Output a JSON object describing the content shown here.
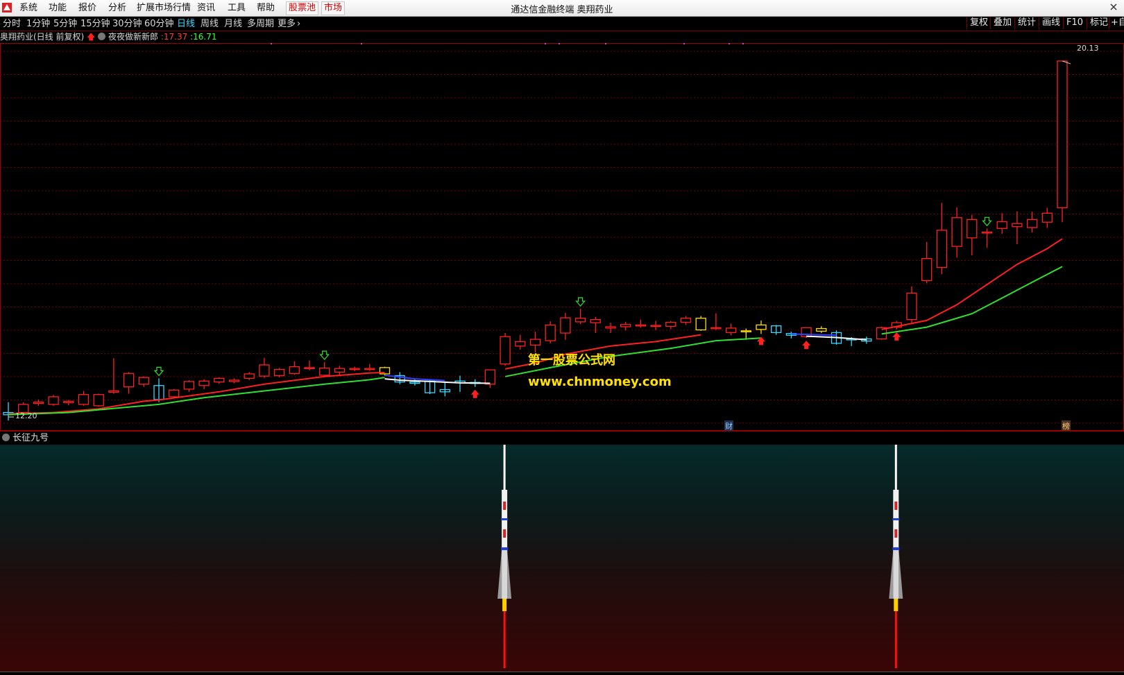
{
  "menu": {
    "items": [
      "系统",
      "功能",
      "报价",
      "分析",
      "扩展市场行情",
      "资讯",
      "工具",
      "帮助"
    ],
    "highlight_items": [
      "股票池",
      "市场"
    ],
    "app_title": "通达信金融终端  奥翔药业"
  },
  "toolbar": {
    "periods": [
      "分时",
      "1分钟",
      "5分钟",
      "15分钟",
      "30分钟",
      "60分钟",
      "日线",
      "周线",
      "月线",
      "多周期",
      "更多"
    ],
    "active_period": "日线",
    "right_buttons": [
      "复权",
      "叠加",
      "统计",
      "画线",
      "F10",
      "标记",
      "+自"
    ]
  },
  "chart_header": {
    "stock_name": "奥翔药业(日线 前复权)",
    "indicator_name": "夜夜做新新郎",
    "value1": ":17.37",
    "value2": ":16.71"
  },
  "price_labels": {
    "high": "20.13",
    "low": "12.20"
  },
  "event_labels": {
    "cai": "财",
    "bang": "榜"
  },
  "watermark": {
    "line1": "第一股票公式网",
    "line2": "www.chnmoney.com"
  },
  "sub_indicator": {
    "name": "长征九号"
  },
  "colors": {
    "up": "#ff2020",
    "down": "#38d8ff",
    "yellow": "#ffe000",
    "ma_red": "#ff2020",
    "ma_green": "#30e030",
    "grid": "#7a0000"
  },
  "chart_data": {
    "type": "candlestick",
    "title": "奥翔药业(日线 前复权)",
    "ylim": [
      12.0,
      20.5
    ],
    "candles": [
      {
        "o": 12.25,
        "h": 12.53,
        "l": 12.12,
        "c": 12.3,
        "k": "down"
      },
      {
        "o": 12.3,
        "h": 12.53,
        "l": 12.22,
        "c": 12.48,
        "k": "up"
      },
      {
        "o": 12.5,
        "h": 12.59,
        "l": 12.45,
        "c": 12.53,
        "k": "up"
      },
      {
        "o": 12.48,
        "h": 12.69,
        "l": 12.45,
        "c": 12.65,
        "k": "up"
      },
      {
        "o": 12.52,
        "h": 12.58,
        "l": 12.46,
        "c": 12.55,
        "k": "up"
      },
      {
        "o": 12.48,
        "h": 12.78,
        "l": 12.45,
        "c": 12.7,
        "k": "up"
      },
      {
        "o": 12.45,
        "h": 12.72,
        "l": 12.43,
        "c": 12.7,
        "k": "up"
      },
      {
        "o": 12.75,
        "h": 13.51,
        "l": 12.72,
        "c": 12.78,
        "k": "up"
      },
      {
        "o": 12.87,
        "h": 13.2,
        "l": 12.72,
        "c": 13.17,
        "k": "up"
      },
      {
        "o": 12.93,
        "h": 13.1,
        "l": 12.87,
        "c": 13.08,
        "k": "up"
      },
      {
        "o": 12.9,
        "h": 13.06,
        "l": 12.53,
        "c": 12.59,
        "k": "down"
      },
      {
        "o": 12.65,
        "h": 12.82,
        "l": 12.62,
        "c": 12.8,
        "k": "up"
      },
      {
        "o": 12.82,
        "h": 13.02,
        "l": 12.76,
        "c": 12.99,
        "k": "up"
      },
      {
        "o": 12.9,
        "h": 13.04,
        "l": 12.82,
        "c": 13.0,
        "k": "up"
      },
      {
        "o": 12.98,
        "h": 13.08,
        "l": 12.94,
        "c": 13.06,
        "k": "up"
      },
      {
        "o": 12.99,
        "h": 13.06,
        "l": 12.95,
        "c": 13.02,
        "k": "up"
      },
      {
        "o": 13.06,
        "h": 13.2,
        "l": 13.02,
        "c": 13.16,
        "k": "up"
      },
      {
        "o": 13.11,
        "h": 13.52,
        "l": 13.07,
        "c": 13.36,
        "k": "up"
      },
      {
        "o": 13.12,
        "h": 13.29,
        "l": 13.08,
        "c": 13.26,
        "k": "up"
      },
      {
        "o": 13.17,
        "h": 13.44,
        "l": 13.14,
        "c": 13.32,
        "k": "up"
      },
      {
        "o": 13.28,
        "h": 13.46,
        "l": 13.24,
        "c": 13.3,
        "k": "up"
      },
      {
        "o": 13.13,
        "h": 13.42,
        "l": 13.1,
        "c": 13.29,
        "k": "up"
      },
      {
        "o": 13.2,
        "h": 13.34,
        "l": 13.11,
        "c": 13.28,
        "k": "up"
      },
      {
        "o": 13.26,
        "h": 13.32,
        "l": 13.22,
        "c": 13.28,
        "k": "up"
      },
      {
        "o": 13.26,
        "h": 13.38,
        "l": 13.23,
        "c": 13.28,
        "k": "up"
      },
      {
        "o": 13.16,
        "h": 13.32,
        "l": 13.12,
        "c": 13.3,
        "k": "yellow"
      },
      {
        "o": 13.12,
        "h": 13.2,
        "l": 12.93,
        "c": 12.98,
        "k": "down"
      },
      {
        "o": 12.98,
        "h": 13.04,
        "l": 12.9,
        "c": 12.95,
        "k": "down"
      },
      {
        "o": 13.0,
        "h": 13.03,
        "l": 12.71,
        "c": 12.74,
        "k": "down"
      },
      {
        "o": 12.76,
        "h": 12.99,
        "l": 12.66,
        "c": 12.81,
        "k": "down"
      },
      {
        "o": 13.0,
        "h": 13.12,
        "l": 12.76,
        "c": 12.96,
        "k": "down"
      },
      {
        "o": 12.97,
        "h": 13.04,
        "l": 12.87,
        "c": 12.95,
        "k": "down"
      },
      {
        "o": 12.93,
        "h": 13.25,
        "l": 12.85,
        "c": 13.25,
        "k": "up"
      },
      {
        "o": 13.38,
        "h": 14.07,
        "l": 13.34,
        "c": 13.99,
        "k": "up"
      },
      {
        "o": 13.78,
        "h": 14.03,
        "l": 13.7,
        "c": 13.88,
        "k": "up"
      },
      {
        "o": 13.8,
        "h": 14.1,
        "l": 13.64,
        "c": 13.93,
        "k": "up"
      },
      {
        "o": 13.9,
        "h": 14.33,
        "l": 13.84,
        "c": 14.25,
        "k": "up"
      },
      {
        "o": 14.07,
        "h": 14.52,
        "l": 13.92,
        "c": 14.41,
        "k": "up"
      },
      {
        "o": 14.32,
        "h": 14.61,
        "l": 14.27,
        "c": 14.4,
        "k": "up"
      },
      {
        "o": 14.3,
        "h": 14.43,
        "l": 14.07,
        "c": 14.37,
        "k": "up"
      },
      {
        "o": 14.18,
        "h": 14.3,
        "l": 14.07,
        "c": 14.21,
        "k": "up"
      },
      {
        "o": 14.21,
        "h": 14.32,
        "l": 14.13,
        "c": 14.26,
        "k": "up"
      },
      {
        "o": 14.24,
        "h": 14.37,
        "l": 14.19,
        "c": 14.25,
        "k": "up"
      },
      {
        "o": 14.22,
        "h": 14.34,
        "l": 14.14,
        "c": 14.24,
        "k": "up"
      },
      {
        "o": 14.22,
        "h": 14.34,
        "l": 14.16,
        "c": 14.31,
        "k": "up"
      },
      {
        "o": 14.31,
        "h": 14.45,
        "l": 14.25,
        "c": 14.4,
        "k": "up"
      },
      {
        "o": 14.4,
        "h": 14.45,
        "l": 14.12,
        "c": 14.14,
        "k": "yellow"
      },
      {
        "o": 14.19,
        "h": 14.51,
        "l": 14.14,
        "c": 14.18,
        "k": "up"
      },
      {
        "o": 14.18,
        "h": 14.28,
        "l": 14.02,
        "c": 14.08,
        "k": "up"
      },
      {
        "o": 14.12,
        "h": 14.17,
        "l": 13.92,
        "c": 14.12,
        "k": "yellow"
      },
      {
        "o": 14.15,
        "h": 14.35,
        "l": 14.05,
        "c": 14.25,
        "k": "yellow"
      },
      {
        "o": 14.23,
        "h": 14.25,
        "l": 14.03,
        "c": 14.08,
        "k": "down"
      },
      {
        "o": 14.06,
        "h": 14.1,
        "l": 13.95,
        "c": 14.02,
        "k": "down"
      },
      {
        "o": 13.99,
        "h": 14.2,
        "l": 13.96,
        "c": 14.19,
        "k": "up"
      },
      {
        "o": 14.11,
        "h": 14.22,
        "l": 14.07,
        "c": 14.17,
        "k": "yellow"
      },
      {
        "o": 14.08,
        "h": 14.13,
        "l": 13.81,
        "c": 13.84,
        "k": "down"
      },
      {
        "o": 13.94,
        "h": 13.98,
        "l": 13.78,
        "c": 13.92,
        "k": "down"
      },
      {
        "o": 13.89,
        "h": 13.99,
        "l": 13.83,
        "c": 13.94,
        "k": "down"
      },
      {
        "o": 13.94,
        "h": 14.21,
        "l": 13.92,
        "c": 14.19,
        "k": "up"
      },
      {
        "o": 14.2,
        "h": 14.34,
        "l": 14.15,
        "c": 14.3,
        "k": "up"
      },
      {
        "o": 14.37,
        "h": 15.11,
        "l": 14.3,
        "c": 14.96,
        "k": "up"
      },
      {
        "o": 15.24,
        "h": 16.1,
        "l": 15.18,
        "c": 15.73,
        "k": "up"
      },
      {
        "o": 15.53,
        "h": 16.97,
        "l": 15.38,
        "c": 16.36,
        "k": "up"
      },
      {
        "o": 16.0,
        "h": 16.87,
        "l": 15.75,
        "c": 16.64,
        "k": "up"
      },
      {
        "o": 16.19,
        "h": 16.7,
        "l": 15.8,
        "c": 16.6,
        "k": "up"
      },
      {
        "o": 16.3,
        "h": 16.4,
        "l": 15.97,
        "c": 16.32,
        "k": "up"
      },
      {
        "o": 16.4,
        "h": 16.74,
        "l": 16.28,
        "c": 16.55,
        "k": "up"
      },
      {
        "o": 16.44,
        "h": 16.78,
        "l": 16.05,
        "c": 16.51,
        "k": "up"
      },
      {
        "o": 16.42,
        "h": 16.77,
        "l": 16.31,
        "c": 16.6,
        "k": "up"
      },
      {
        "o": 16.54,
        "h": 16.86,
        "l": 16.41,
        "c": 16.74,
        "k": "up"
      },
      {
        "o": 16.86,
        "h": 20.13,
        "l": 16.54,
        "c": 20.13,
        "k": "up"
      }
    ],
    "ma_red": [
      [
        0,
        12.27
      ],
      [
        3,
        12.3
      ],
      [
        6,
        12.38
      ],
      [
        9,
        12.55
      ],
      [
        10,
        12.58
      ],
      [
        14,
        12.76
      ],
      [
        17,
        12.93
      ],
      [
        21,
        13.1
      ],
      [
        24,
        13.18
      ],
      [
        25,
        13.19
      ],
      [
        33,
        13.27
      ],
      [
        35,
        13.4
      ],
      [
        37,
        13.6
      ],
      [
        40,
        13.78
      ],
      [
        43,
        13.88
      ],
      [
        46,
        14.03
      ],
      [
        58,
        14.15
      ],
      [
        61,
        14.35
      ],
      [
        63,
        14.7
      ],
      [
        65,
        15.15
      ],
      [
        67,
        15.6
      ],
      [
        69,
        15.95
      ],
      [
        70,
        16.17
      ]
    ],
    "ma_green": [
      [
        0,
        12.25
      ],
      [
        4,
        12.3
      ],
      [
        8,
        12.42
      ],
      [
        10,
        12.48
      ],
      [
        13,
        12.63
      ],
      [
        17,
        12.78
      ],
      [
        21,
        12.93
      ],
      [
        24,
        13.03
      ],
      [
        25,
        13.08
      ],
      [
        33,
        13.1
      ],
      [
        36,
        13.3
      ],
      [
        40,
        13.55
      ],
      [
        44,
        13.73
      ],
      [
        47,
        13.9
      ],
      [
        50,
        13.96
      ],
      [
        58,
        14.05
      ],
      [
        61,
        14.2
      ],
      [
        64,
        14.5
      ],
      [
        66,
        14.85
      ],
      [
        68,
        15.2
      ],
      [
        70,
        15.55
      ]
    ],
    "ma_white": [
      [
        25,
        13.05
      ],
      [
        26,
        13.02
      ],
      [
        28,
        12.99
      ],
      [
        30,
        12.96
      ],
      [
        32,
        12.95
      ],
      [
        53,
        14.0
      ],
      [
        55,
        13.97
      ],
      [
        57,
        13.92
      ]
    ],
    "ma_blue": [
      [
        25,
        13.13
      ],
      [
        27,
        13.05
      ],
      [
        29,
        13.01
      ],
      [
        52,
        14.05
      ],
      [
        55,
        14.02
      ]
    ],
    "signals": [
      {
        "i": 10,
        "type": "sell",
        "color": "#30e030"
      },
      {
        "i": 21,
        "type": "sell",
        "color": "#30e030"
      },
      {
        "i": 38,
        "type": "sell",
        "color": "#30e030"
      },
      {
        "i": 65,
        "type": "sell",
        "color": "#30e030"
      },
      {
        "i": 31,
        "type": "buy",
        "color": "#ff2020"
      },
      {
        "i": 50,
        "type": "buy",
        "color": "#ff2020"
      },
      {
        "i": 53,
        "type": "buy",
        "color": "#ff2020"
      },
      {
        "i": 59,
        "type": "buy",
        "color": "#ff2020"
      }
    ],
    "rockets_at": [
      33,
      59
    ]
  }
}
